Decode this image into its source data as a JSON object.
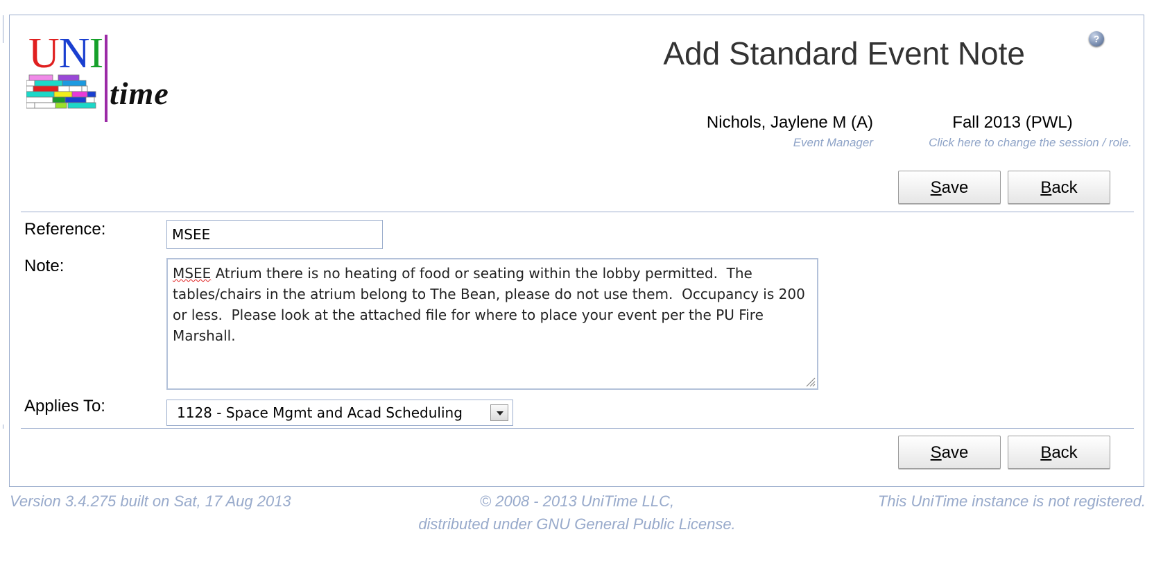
{
  "header": {
    "logo_uni": [
      "U",
      "N",
      "I"
    ],
    "logo_time": "time",
    "title": "Add Standard Event Note",
    "help_icon": "question-mark-circle-icon",
    "user": {
      "name": "Nichols, Jaylene M (A)",
      "role": "Event Manager"
    },
    "session": {
      "name": "Fall 2013 (PWL)",
      "hint": "Click here to change the session / role."
    }
  },
  "buttons": {
    "save": {
      "accel": "S",
      "rest": "ave"
    },
    "back": {
      "accel": "B",
      "rest": "ack"
    }
  },
  "form": {
    "reference": {
      "label": "Reference:",
      "value": "MSEE"
    },
    "note": {
      "label": "Note:",
      "first_word": "MSEE",
      "value_rest": " Atrium there is no heating of food or seating within the lobby permitted.  The tables/chairs in the atrium belong to The Bean, please do not use them.  Occupancy is 200 or less.  Please look at the attached file for where to place your event per the PU Fire Marshall."
    },
    "applies_to": {
      "label": "Applies To:",
      "selected": "1128 - Space Mgmt and Acad Scheduling"
    }
  },
  "footer": {
    "version": "Version 3.4.275 built on Sat, 17 Aug 2013",
    "copyright": "© 2008 - 2013 UniTime LLC,",
    "license": "distributed under GNU General Public License.",
    "registration": "This UniTime instance is not registered."
  },
  "colors": {
    "border": "#9aaccc",
    "hint_text": "#8ea3c7",
    "footer_text": "#98aacb",
    "title_text": "#333333"
  }
}
